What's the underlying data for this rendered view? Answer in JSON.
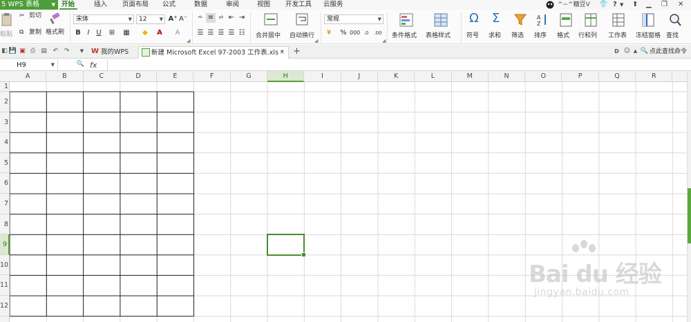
{
  "menubar": {
    "app_label": "5 WPS 表格",
    "tabs": [
      "开始",
      "插入",
      "页面布局",
      "公式",
      "数据",
      "审阅",
      "视图",
      "开发工具",
      "云服务"
    ],
    "active_tab": "开始",
    "user_name": "^~^糖豆V",
    "help_label": "?"
  },
  "ribbon": {
    "paste_label": "粘贴",
    "cut_label": "剪切",
    "copy_label": "复制",
    "format_painter_label": "格式刷",
    "font_name": "宋体",
    "font_size": "12",
    "bold": "B",
    "italic": "I",
    "underline": "U",
    "merge_center_label": "合并居中",
    "wrap_text_label": "自动换行",
    "number_format": "常规",
    "conditional_format_label": "条件格式",
    "table_style_label": "表格样式",
    "symbol_label": "符号",
    "sum_label": "求和",
    "filter_label": "筛选",
    "sort_label": "排序",
    "format_label": "格式",
    "rows_cols_label": "行和列",
    "worksheet_label": "工作表",
    "freeze_label": "冻结窗格",
    "find_label": "查找"
  },
  "quickbar": {
    "tabs": [
      {
        "label": "我的WPS",
        "active": false
      },
      {
        "label": "新建 Microsoft Excel 97-2003 工作表.xls *",
        "active": true
      }
    ],
    "command_search": "点此查找命令"
  },
  "formula": {
    "name_box": "H9",
    "fx_label": "fx",
    "content": ""
  },
  "sheet": {
    "columns": [
      "A",
      "B",
      "C",
      "D",
      "E",
      "F",
      "G",
      "H",
      "I",
      "J",
      "K",
      "L",
      "M",
      "N",
      "O",
      "P",
      "Q",
      "R"
    ],
    "rows": [
      "1",
      "2",
      "3",
      "4",
      "5",
      "6",
      "7",
      "8",
      "9",
      "10",
      "11",
      "12"
    ],
    "selected_cell": "H9",
    "bordered_range": "A2:E12"
  },
  "watermark": {
    "brand": "Bai du 经验",
    "url": "jingyan.baidu.com"
  },
  "colors": {
    "accent": "#4d9e3a",
    "selection": "#4d8a30"
  }
}
